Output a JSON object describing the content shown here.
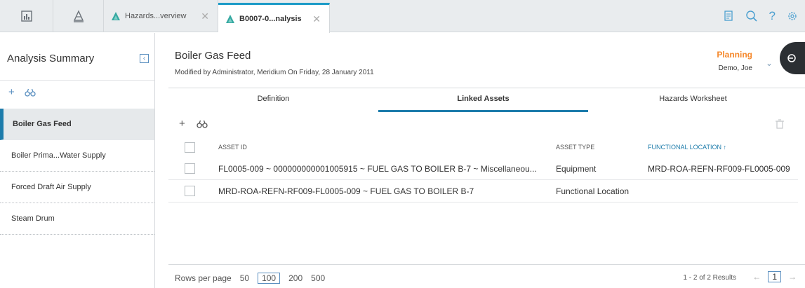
{
  "topbar": {
    "tabs": [
      {
        "label": "Hazards...verview",
        "close": "✕"
      },
      {
        "label": "B0007-0...nalysis",
        "close": "✕"
      }
    ],
    "icons": [
      "dashboard-icon",
      "asset-hierarchy-icon",
      "document-icon",
      "search-icon",
      "help-icon",
      "settings-icon"
    ],
    "help_glyph": "?"
  },
  "sidebar": {
    "title": "Analysis Summary",
    "items": [
      {
        "label": "Boiler Gas Feed",
        "selected": true
      },
      {
        "label": "Boiler Prima...Water Supply"
      },
      {
        "label": "Forced Draft Air Supply"
      },
      {
        "label": "Steam Drum"
      }
    ]
  },
  "header": {
    "title": "Boiler Gas Feed",
    "subtitle": "Modified by Administrator, Meridium On Friday, 28 January 2011",
    "state": "Planning",
    "owner": "Demo, Joe"
  },
  "tabs": [
    {
      "label": "Definition"
    },
    {
      "label": "Linked Assets",
      "active": true
    },
    {
      "label": "Hazards Worksheet"
    }
  ],
  "grid": {
    "columns": [
      "ASSET ID",
      "ASSET TYPE",
      "FUNCTIONAL LOCATION ↑"
    ],
    "rows": [
      {
        "asset_id": "FL0005-009 ~ 000000000001005915 ~ FUEL GAS TO BOILER B-7 ~ Miscellaneou...",
        "asset_type": "Equipment",
        "functional_location": "MRD-ROA-REFN-RF009-FL0005-009"
      },
      {
        "asset_id": "MRD-ROA-REFN-RF009-FL0005-009 ~ FUEL GAS TO BOILER B-7",
        "asset_type": "Functional Location",
        "functional_location": ""
      }
    ]
  },
  "footer": {
    "rows_per_page_label": "Rows per page",
    "options": [
      "50",
      "100",
      "200",
      "500"
    ],
    "selected_option": "100",
    "results": "1 - 2 of 2 Results",
    "page": "1"
  },
  "colors": {
    "accent": "#1d7cab",
    "state": "#f5882b",
    "topbar": "#e9ecee"
  }
}
